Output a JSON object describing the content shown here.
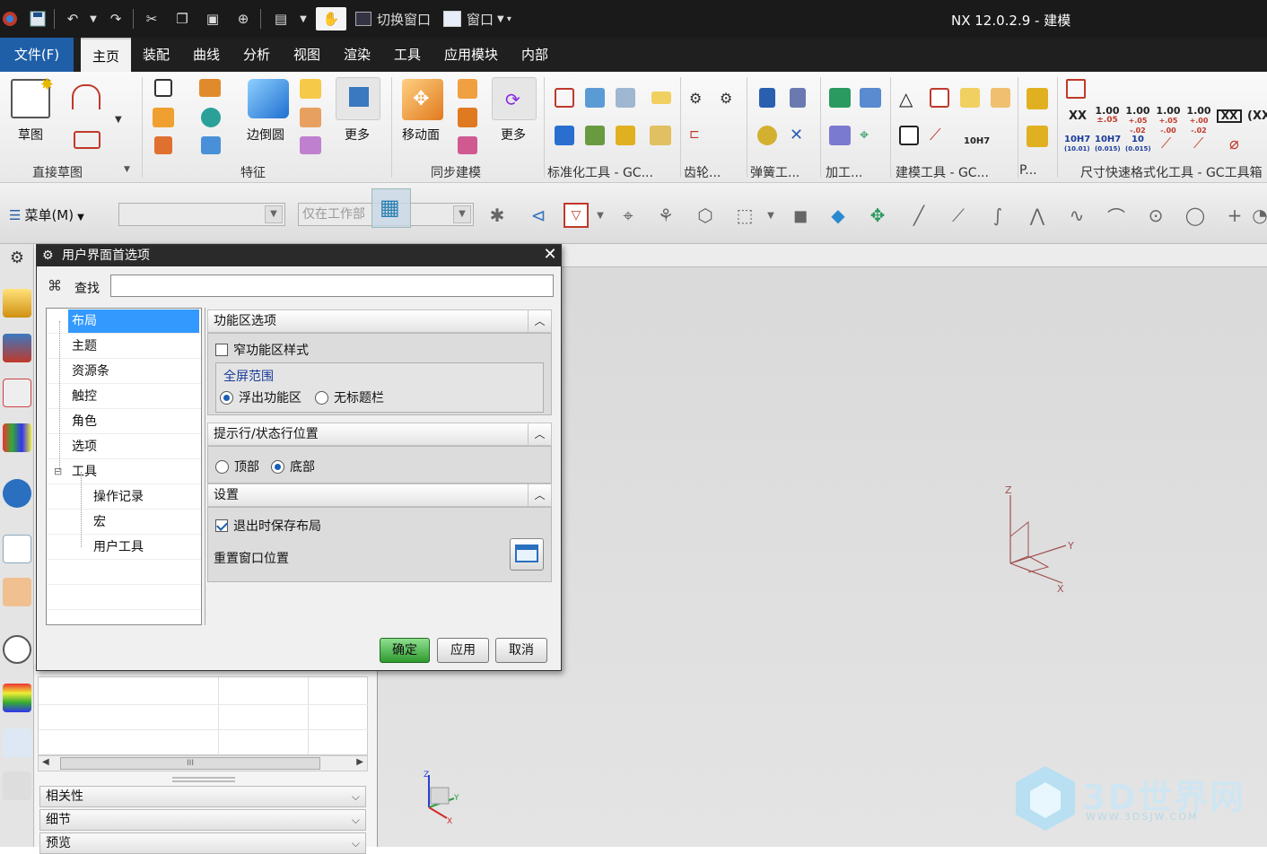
{
  "app": {
    "title": "NX 12.0.2.9 - 建模"
  },
  "quick_access": {
    "switch_window": "切换窗口",
    "window": "窗口"
  },
  "tabs": [
    {
      "label": "文件(F)"
    },
    {
      "label": "主页"
    },
    {
      "label": "装配"
    },
    {
      "label": "曲线"
    },
    {
      "label": "分析"
    },
    {
      "label": "视图"
    },
    {
      "label": "渲染"
    },
    {
      "label": "工具"
    },
    {
      "label": "应用模块"
    },
    {
      "label": "内部"
    }
  ],
  "ribbon": {
    "sketch_label": "草图",
    "edge_blend_label": "边倒圆",
    "more_label_1": "更多",
    "move_face_label": "移动面",
    "more_label_2": "更多",
    "groups": {
      "direct_sketch": "直接草图",
      "feature": "特征",
      "sync_modeling": "同步建模",
      "std_tools": "标准化工具 - GC...",
      "gear": "齿轮...",
      "spring": "弹簧工...",
      "machining": "加工...",
      "modeling_tools": "建模工具 - GC...",
      "p": "P...",
      "dim_format": "尺寸快速格式化工具 - GC工具箱"
    },
    "tolerances": [
      {
        "main": "XX",
        "sub": ""
      },
      {
        "main": "1.00",
        "sub": "±.05"
      },
      {
        "main": "1.00",
        "sub": "+.05 -.02"
      },
      {
        "main": "1.00",
        "sub": "+.05 -.00"
      },
      {
        "main": "1.00",
        "sub": "+.00 -.02"
      },
      {
        "main": "XX",
        "sub": ""
      },
      {
        "main": "(XX",
        "sub": ""
      }
    ],
    "fits": [
      {
        "main": "10H7",
        "sub": "(10.01)"
      },
      {
        "main": "10H7",
        "sub": "(0.015)"
      },
      {
        "main": "10",
        "sub": "(0.015)"
      }
    ],
    "small_10h7": "10H7"
  },
  "toolbar": {
    "menu_label": "菜单(M)",
    "filter_placeholder": "",
    "scope_placeholder": "仅在工作部"
  },
  "dialog": {
    "title": "用户界面首选项",
    "search_label": "查找",
    "search_value": "",
    "tree": [
      {
        "label": "布局",
        "selected": true
      },
      {
        "label": "主题"
      },
      {
        "label": "资源条"
      },
      {
        "label": "触控"
      },
      {
        "label": "角色"
      },
      {
        "label": "选项"
      },
      {
        "label": "工具",
        "expanded": true
      },
      {
        "label": "操作记录",
        "child": true
      },
      {
        "label": "宏",
        "child": true
      },
      {
        "label": "用户工具",
        "child": true
      }
    ],
    "ribbon_options": {
      "header": "功能区选项",
      "narrow_style": "窄功能区样式",
      "narrow_style_checked": false,
      "fullscreen_group": "全屏范围",
      "float_ribbon": "浮出功能区",
      "no_title_bar": "无标题栏",
      "fullscreen_selected": "浮出功能区"
    },
    "status_position": {
      "header": "提示行/状态行位置",
      "top": "顶部",
      "bottom": "底部",
      "selected": "底部"
    },
    "settings": {
      "header": "设置",
      "save_layout_on_exit": "退出时保存布局",
      "save_layout_checked": true,
      "reset_window_position": "重置窗口位置"
    },
    "buttons": {
      "ok": "确定",
      "apply": "应用",
      "cancel": "取消"
    }
  },
  "navigator": {
    "scroll_grip": "III",
    "sections": [
      {
        "label": "相关性"
      },
      {
        "label": "细节"
      },
      {
        "label": "预览"
      }
    ]
  },
  "viewport": {
    "triad_labels": {
      "z": "Z",
      "y": "Y",
      "x": "X"
    },
    "watermark": "3D世界网",
    "watermark_url": "WWW.3DSJW.COM"
  }
}
